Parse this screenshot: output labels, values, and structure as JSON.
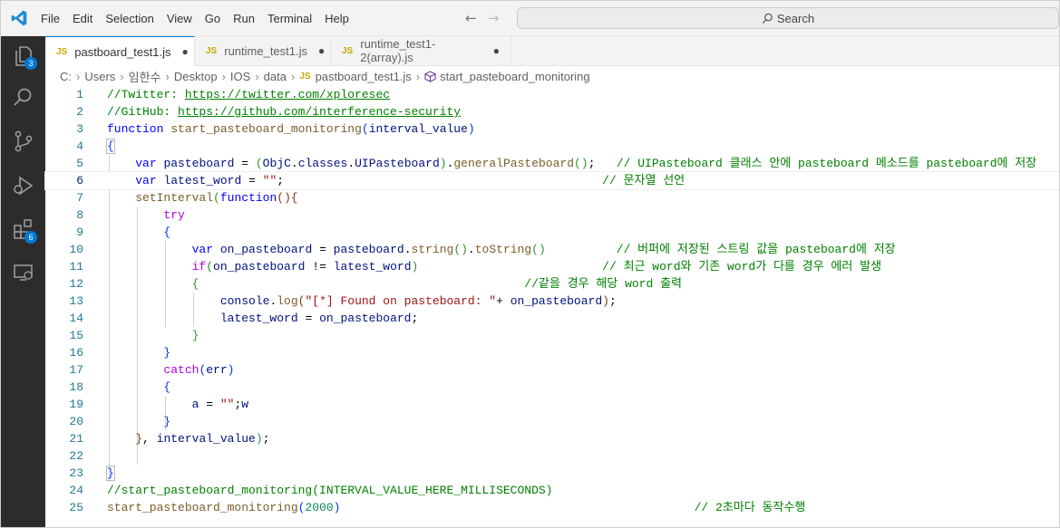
{
  "menu": [
    "File",
    "Edit",
    "Selection",
    "View",
    "Go",
    "Run",
    "Terminal",
    "Help"
  ],
  "search": {
    "label": "Search"
  },
  "activity_badges": {
    "explorer": "3",
    "extensions": "6"
  },
  "tabs": [
    {
      "label": "pastboard_test1.js",
      "icon": "JS",
      "dirty": "●",
      "active": true
    },
    {
      "label": "runtime_test1.js",
      "icon": "JS",
      "dirty": "●",
      "active": false
    },
    {
      "label": "runtime_test1-2(array).js",
      "icon": "JS",
      "dirty": "●",
      "active": false
    }
  ],
  "breadcrumb": [
    "C:",
    "Users",
    "임한수",
    "Desktop",
    "IOS",
    "data",
    "pastboard_test1.js",
    "start_pasteboard_monitoring"
  ],
  "accent_color": "#0078d4",
  "code": {
    "l1_c": "//Twitter: ",
    "l1_u": "https://twitter.com/xploresec",
    "l2_c": "//GitHub: ",
    "l2_u": "https://github.com/interference-security",
    "l3_kw": "function",
    "l3_fn": "start_pasteboard_monitoring",
    "l3_p": "interval_value",
    "l5_a": "var",
    "l5_b": "pasteboard",
    "l5_c": "ObjC",
    "l5_d": "classes",
    "l5_e": "UIPasteboard",
    "l5_f": "generalPasteboard",
    "l5_cm": "// UIPasteboard 클래스 안에 pasteboard 메소드를 pasteboard에 저장",
    "l6_a": "var",
    "l6_b": "latest_word",
    "l6_s": "\"\"",
    "l6_cm": "// 문자열 선언",
    "l7_fn": "setInterval",
    "l7_kw": "function",
    "l8_kw": "try",
    "l10_a": "var",
    "l10_b": "on_pasteboard",
    "l10_c": "pasteboard",
    "l10_d": "string",
    "l10_e": "toString",
    "l10_cm": "// 버퍼에 저장된 스트링 값을 pasteboard에 저장",
    "l11_kw": "if",
    "l11_a": "on_pasteboard",
    "l11_b": "latest_word",
    "l11_cm": "// 최근 word와 기존 word가 다를 경우 에러 발생",
    "l12_cm": "//같을 경우 해당 word 출력",
    "l13_a": "console",
    "l13_b": "log",
    "l13_s": "\"[*] Found on pasteboard: \"",
    "l13_c": "on_pasteboard",
    "l14_a": "latest_word",
    "l14_b": "on_pasteboard",
    "l17_kw": "catch",
    "l17_v": "err",
    "l19_a": "a",
    "l19_s": "\"\"",
    "l19_w": "w",
    "l21_v": "interval_value",
    "l24_cm": "//start_pasteboard_monitoring(INTERVAL_VALUE_HERE_MILLISECONDS)",
    "l25_fn": "start_pasteboard_monitoring",
    "l25_n": "2000",
    "l25_cm": "// 2초마다 동작수행"
  },
  "line_numbers": [
    "1",
    "2",
    "3",
    "4",
    "5",
    "6",
    "7",
    "8",
    "9",
    "10",
    "11",
    "12",
    "13",
    "14",
    "15",
    "16",
    "17",
    "18",
    "19",
    "20",
    "21",
    "22",
    "23",
    "24",
    "25"
  ]
}
